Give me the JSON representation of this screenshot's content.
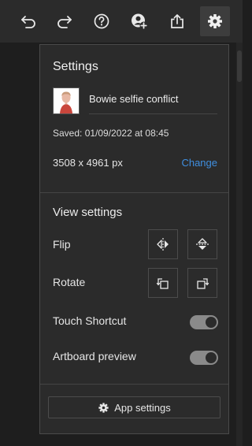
{
  "toolbar": {
    "icons": [
      "undo-icon",
      "redo-icon",
      "help-icon",
      "add-user-icon",
      "share-icon",
      "gear-icon"
    ]
  },
  "settings": {
    "title": "Settings",
    "document_name": "Bowie selfie conflict",
    "saved": "Saved: 01/09/2022 at 08:45",
    "dimensions": "3508 x 4961 px",
    "change_label": "Change"
  },
  "view_settings": {
    "title": "View settings",
    "flip_label": "Flip",
    "rotate_label": "Rotate",
    "touch_shortcut_label": "Touch Shortcut",
    "touch_shortcut_on": true,
    "artboard_preview_label": "Artboard preview",
    "artboard_preview_on": true
  },
  "footer": {
    "app_settings_label": "App settings"
  },
  "colors": {
    "background": "#1e1e1e",
    "panel": "#2b2b2b",
    "link": "#3f8fe0",
    "toggle": "#8a8a8a"
  }
}
